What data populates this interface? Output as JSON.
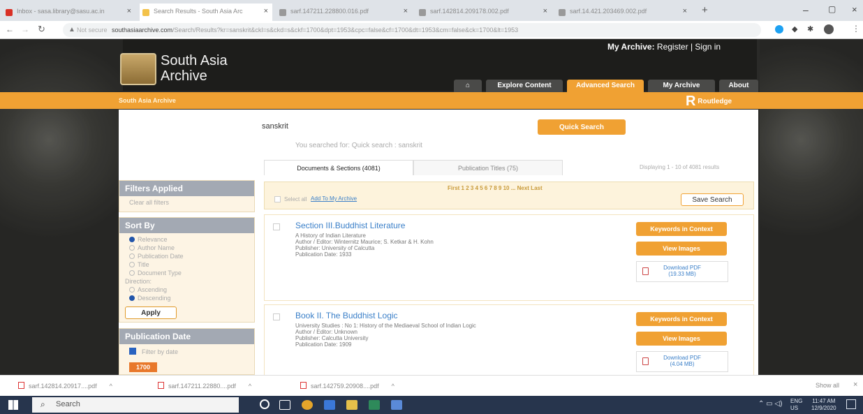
{
  "browser": {
    "tabs": [
      {
        "label": "Inbox - sasa.library@sasu.ac.in",
        "color": "#d93025"
      },
      {
        "label": "Search Results - South Asia Arc",
        "color": "#f3c24a"
      },
      {
        "label": "sarf.147211.228800.016.pdf",
        "color": "#777777"
      },
      {
        "label": "sarf.142814.209178.002.pdf",
        "color": "#777777"
      },
      {
        "label": "sarf.14.421.203469.002.pdf",
        "color": "#777777"
      }
    ],
    "security_label": "Not secure",
    "url_host": "southasiaarchive.com",
    "url_path": "/Search/Results?kr=sanskrit&ckl=s&ckd=s&ckf=1700&dpt=1953&cpc=false&cf=1700&dt=1953&cm=false&ck=1700&lt=1953"
  },
  "site": {
    "logo_line1": "South Asia",
    "logo_line2": "Archive",
    "my_archive_label": "My Archive:",
    "register": "Register",
    "sign_in": "Sign in",
    "nav": [
      "Explore Content",
      "Advanced Search",
      "My Archive",
      "About"
    ],
    "breadcrumb": "South Asia Archive",
    "publisher": "Routledge"
  },
  "search": {
    "query": "sanskrit",
    "quick_search": "Quick Search",
    "you_searched": "You searched for: Quick search : sanskrit",
    "tab_documents": "Documents & Sections (4081)",
    "tab_titles": "Publication Titles (75)",
    "displaying": "Displaying 1 - 10 of 4081 results"
  },
  "filters": {
    "applied_title": "Filters Applied",
    "clear_all": "Clear all filters",
    "sort_title": "Sort By",
    "sort_options": [
      "Relevance",
      "Author Name",
      "Publication Date",
      "Title",
      "Document Type"
    ],
    "direction_label": "Direction:",
    "direction_options": [
      "Ascending",
      "Descending"
    ],
    "apply": "Apply",
    "pubdate_title": "Publication Date",
    "filter_by_date": "Filter by date",
    "year_from": "1700"
  },
  "results_bar": {
    "select_all": "Select all",
    "add_to_archive": "Add To My Archive",
    "pagination": "First 1 2 3 4 5 6 7 8 9 10 ... Next Last",
    "save_search": "Save Search"
  },
  "results": [
    {
      "title": "Section III.Buddhist Literature",
      "line1": "A History of Indian Literature",
      "author": "Author / Editor: Winternitz Maurice; S. Ketkar & H. Kohn",
      "publisher": "Publisher: University of Calcutta",
      "date": "Publication Date: 1933",
      "kwic": "Keywords in Context",
      "view": "View Images",
      "download": "Download PDF",
      "size": "(19.33 MB)"
    },
    {
      "title": "Book II. The Buddhist Logic",
      "line1": "University Studies : No 1: History of the Mediaeval School of Indian Logic",
      "author": "Author / Editor: Unknown",
      "publisher": "Publisher: Calcutta University",
      "date": "Publication Date: 1909",
      "kwic": "Keywords in Context",
      "view": "View Images",
      "download": "Download PDF",
      "size": "(4.04 MB)"
    }
  ],
  "downloads": [
    "sarf.142814.20917....pdf",
    "sarf.147211.22880....pdf",
    "sarf.142759.20908....pdf"
  ],
  "show_all": "Show all",
  "taskbar": {
    "search": "Search",
    "lang": "ENG",
    "region": "US",
    "time": "11:47 AM",
    "date": "12/9/2020"
  }
}
